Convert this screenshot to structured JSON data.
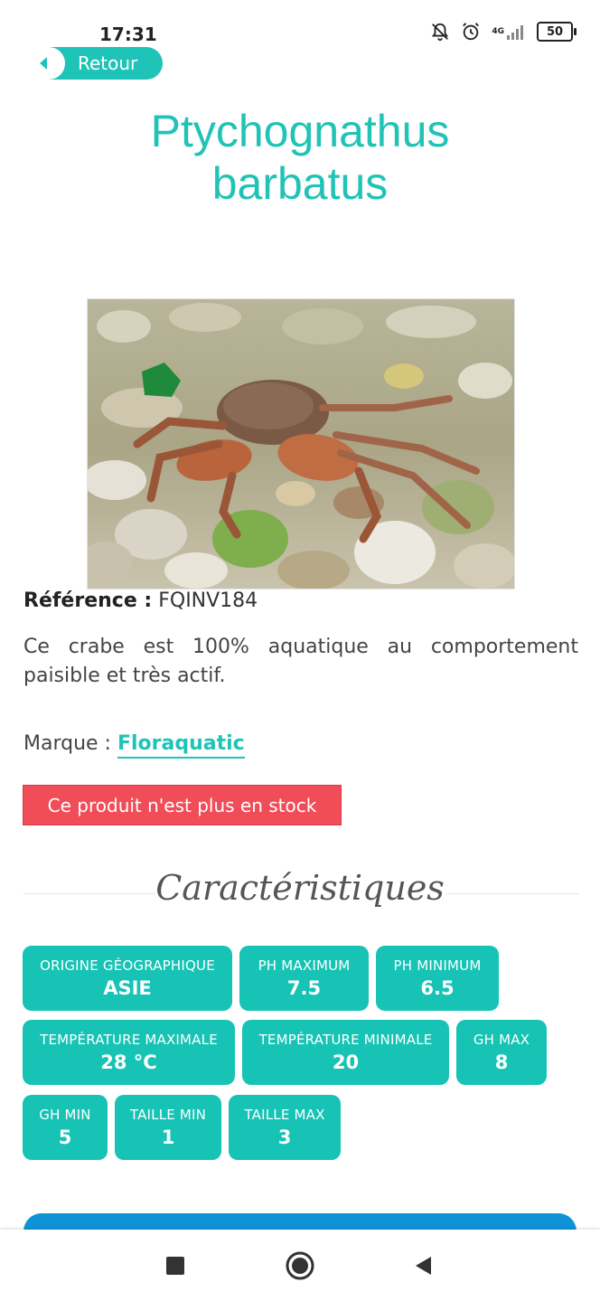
{
  "status_bar": {
    "time": "17:31",
    "network": "4G",
    "battery": "50"
  },
  "back": {
    "label": "Retour"
  },
  "product": {
    "title_line1": "Ptychognathus",
    "title_line2": "barbatus",
    "reference_label": "Référence :",
    "reference_value": "FQINV184",
    "description": "Ce crabe est 100% aquatique au comportement paisible et très actif.",
    "brand_label": "Marque :",
    "brand_value": "Floraquatic",
    "stock_message": "Ce produit n'est plus en stock"
  },
  "characteristics": {
    "title": "Caractéristiques",
    "items": [
      {
        "key": "ORIGINE GÉOGRAPHIQUE",
        "value": "ASIE"
      },
      {
        "key": "PH MAXIMUM",
        "value": "7.5"
      },
      {
        "key": "PH MINIMUM",
        "value": "6.5"
      },
      {
        "key": "TEMPÉRATURE MAXIMALE",
        "value": "28 °C"
      },
      {
        "key": "TEMPÉRATURE MINIMALE",
        "value": "20"
      },
      {
        "key": "GH MAX",
        "value": "8"
      },
      {
        "key": "GH MIN",
        "value": "5"
      },
      {
        "key": "TAILLE MIN",
        "value": "1"
      },
      {
        "key": "TAILLE MAX",
        "value": "3"
      }
    ]
  },
  "colors": {
    "accent": "#1fc4b8",
    "chip": "#16c3b5",
    "stock_bg": "#f04d59",
    "cta": "#0e94d6"
  },
  "icons": [
    "mute-icon",
    "alarm-icon",
    "signal-icon",
    "battery-icon",
    "chevron-left-icon",
    "nav-recents-icon",
    "nav-home-icon",
    "nav-back-icon"
  ]
}
